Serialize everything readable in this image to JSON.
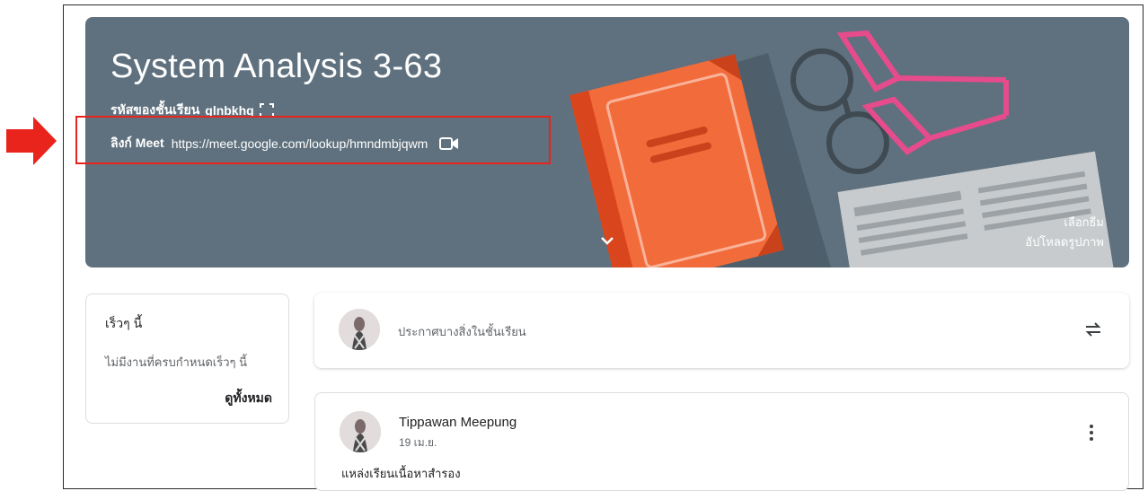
{
  "classroom": {
    "title": "System Analysis 3-63",
    "class_code_label": "รหัสของชั้นเรียน",
    "class_code": "glnbkhq",
    "meet_label": "ลิงก์ Meet",
    "meet_url": "https://meet.google.com/lookup/hmndmbjqwm"
  },
  "theme_links": {
    "select_theme": "เลือกธีม",
    "upload_photo": "อัปโหลดรูปภาพ"
  },
  "upcoming": {
    "heading": "เร็วๆ นี้",
    "empty_text": "ไม่มีงานที่ครบกำหนดเร็วๆ นี้",
    "view_all": "ดูทั้งหมด"
  },
  "announce": {
    "placeholder": "ประกาศบางสิ่งในชั้นเรียน"
  },
  "post": {
    "author": "Tippawan Meepung",
    "date": "19 เม.ย.",
    "body": "แหล่งเรียนเนื้อหาสำรอง"
  },
  "colors": {
    "banner": "#5f717e",
    "highlight": "#e8241c",
    "arrow": "#e8241c",
    "book": "#f26b3a"
  },
  "icons": [
    "fullscreen-icon",
    "video-camera-icon",
    "chevron-down-icon",
    "repost-icon",
    "more-vert-icon",
    "red-arrow-icon"
  ]
}
